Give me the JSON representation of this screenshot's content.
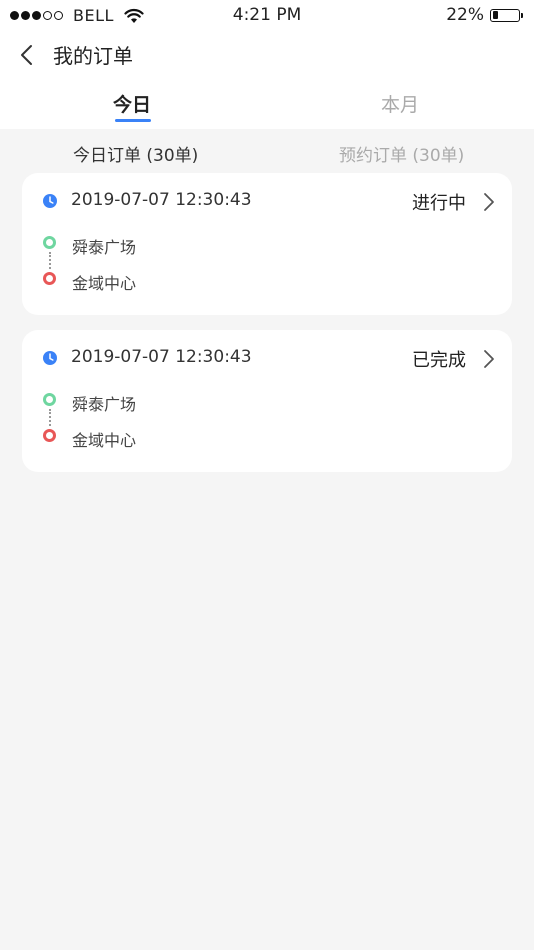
{
  "status_bar": {
    "carrier": "BELL",
    "time": "4:21 PM",
    "battery": "22%",
    "battery_level": 0.22,
    "signal_bars_filled": 3,
    "signal_bars_total": 5
  },
  "nav": {
    "title": "我的订单"
  },
  "tabs": [
    {
      "label": "今日",
      "active": true
    },
    {
      "label": "本月",
      "active": false
    }
  ],
  "subtabs": [
    {
      "label": "今日订单 (30单)",
      "active": true
    },
    {
      "label": "预约订单 (30单)",
      "active": false
    }
  ],
  "orders": [
    {
      "datetime": "2019-07-07 12:30:43",
      "status": "进行中",
      "start": "舜泰广场",
      "end": "金域中心"
    },
    {
      "datetime": "2019-07-07 12:30:43",
      "status": "已完成",
      "start": "舜泰广场",
      "end": "金域中心"
    }
  ],
  "colors": {
    "accent": "#3a82f7",
    "start_marker": "#6fd6a0",
    "end_marker": "#e85757",
    "background": "#f5f5f5"
  }
}
